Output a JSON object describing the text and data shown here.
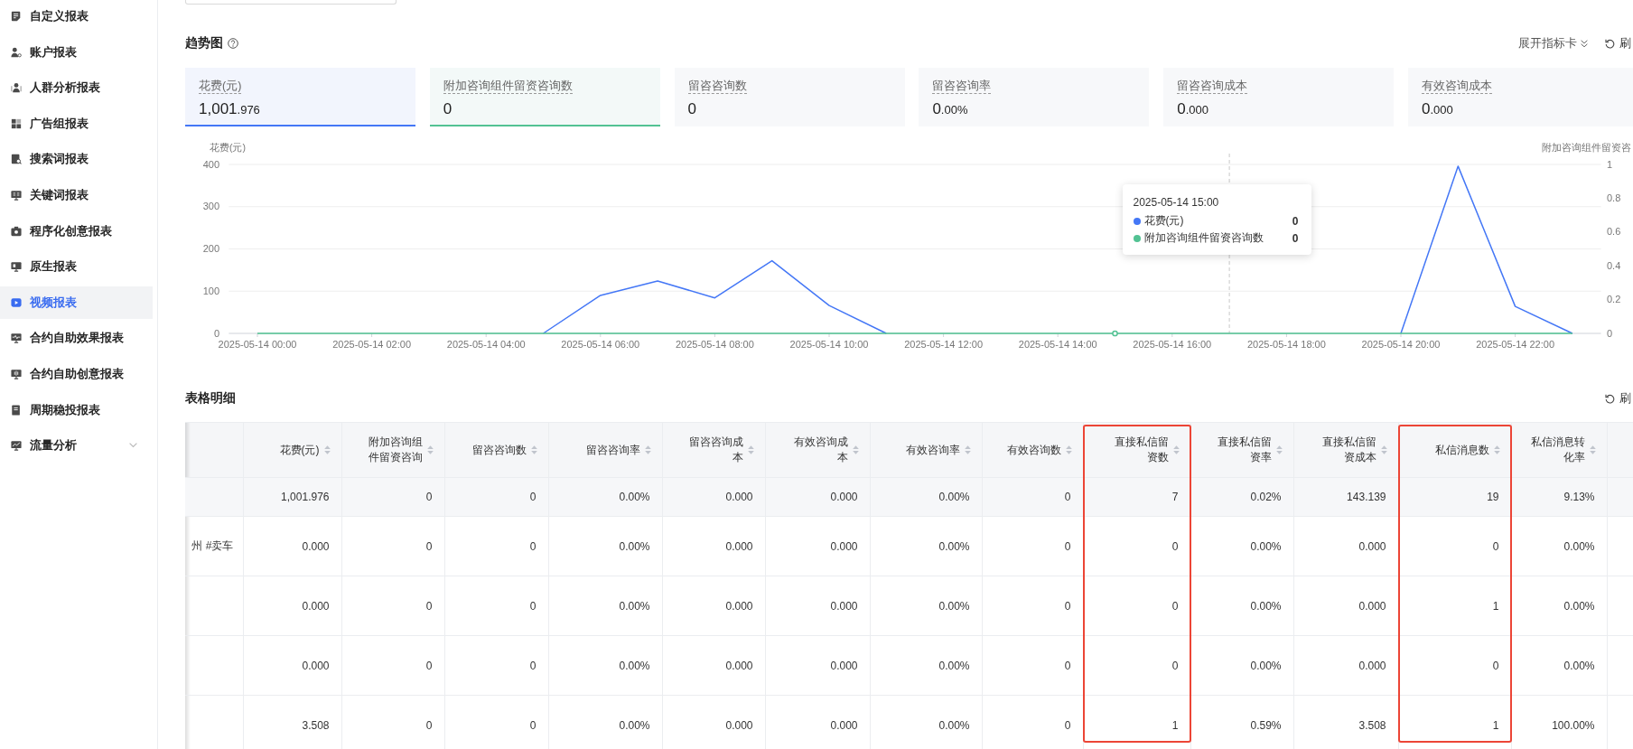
{
  "sidebar": {
    "items": [
      {
        "label": "自定义报表",
        "selected": false,
        "kind": "page"
      },
      {
        "label": "账户报表",
        "selected": false,
        "kind": "page"
      },
      {
        "label": "人群分析报表",
        "selected": false,
        "kind": "page"
      },
      {
        "label": "广告组报表",
        "selected": false,
        "kind": "page"
      },
      {
        "label": "搜索词报表",
        "selected": false,
        "kind": "page"
      },
      {
        "label": "关键词报表",
        "selected": false,
        "kind": "page"
      },
      {
        "label": "程序化创意报表",
        "selected": false,
        "kind": "page"
      },
      {
        "label": "原生报表",
        "selected": false,
        "kind": "page"
      },
      {
        "label": "视频报表",
        "selected": true,
        "kind": "page"
      },
      {
        "label": "合约自助效果报表",
        "selected": false,
        "kind": "page"
      },
      {
        "label": "合约自助创意报表",
        "selected": false,
        "kind": "page"
      },
      {
        "label": "周期稳投报表",
        "selected": false,
        "kind": "page"
      },
      {
        "label": "流量分析",
        "selected": false,
        "kind": "group"
      }
    ]
  },
  "trend": {
    "title": "趋势图",
    "expand_button": "展开指标卡",
    "refresh_button": "刷",
    "metric_cards": [
      {
        "label": "花费(元)",
        "value": "1,001.976",
        "selected": true,
        "color": "#4477f6"
      },
      {
        "label": "附加咨询组件留资咨询数",
        "value": "0",
        "selected": true,
        "color": "#52c293"
      },
      {
        "label": "留咨咨询数",
        "value": "0",
        "selected": false
      },
      {
        "label": "留咨咨询率",
        "value": "0.00%",
        "selected": false
      },
      {
        "label": "留咨咨询成本",
        "value": "0.000",
        "selected": false
      },
      {
        "label": "有效咨询成本",
        "value": "0.000",
        "selected": false
      }
    ],
    "chart_data": {
      "type": "line",
      "ylabel": "花费(元)",
      "y2label": "附加咨询组件留资咨",
      "grid": true,
      "legend": "upper right",
      "categories": [
        "2025-05-14 00:00",
        null,
        "2025-05-14 02:00",
        null,
        "2025-05-14 04:00",
        null,
        "2025-05-14 06:00",
        null,
        "2025-05-14 08:00",
        null,
        "2025-05-14 10:00",
        null,
        "2025-05-14 12:00",
        null,
        "2025-05-14 14:00",
        null,
        "2025-05-14 16:00",
        null,
        "2025-05-14 18:00",
        null,
        "2025-05-14 20:00",
        null,
        "2025-05-14 22:00",
        null
      ],
      "ylim": [
        0,
        400
      ],
      "yticks": [
        0,
        100,
        200,
        300,
        400
      ],
      "y2lim": [
        0,
        1
      ],
      "y2ticks": [
        0,
        0.2,
        0.4,
        0.6,
        0.8,
        1
      ],
      "series": [
        {
          "name": "花费(元)",
          "color": "#4477f6",
          "values": [
            null,
            null,
            null,
            null,
            null,
            0,
            90,
            124,
            84,
            172,
            66,
            0,
            null,
            null,
            null,
            null,
            null,
            null,
            null,
            null,
            0,
            396,
            64,
            0
          ]
        },
        {
          "name": "附加咨询组件留资咨询数",
          "color": "#52c293",
          "axis": "y2",
          "values": [
            0,
            0,
            0,
            0,
            0,
            0,
            0,
            0,
            0,
            0,
            0,
            0,
            0,
            0,
            0,
            0,
            0,
            0,
            0,
            0,
            0,
            0,
            0,
            0
          ]
        }
      ]
    },
    "tooltip": {
      "title": "2025-05-14 15:00",
      "values": [
        "0",
        "0"
      ]
    }
  },
  "details": {
    "title": "表格明细",
    "refresh_button": "刷",
    "table": {
      "columns": [
        {
          "label": "花费(元)",
          "highlighted": false
        },
        {
          "label": "附加咨询组件留资咨询",
          "highlighted": false
        },
        {
          "label": "留咨咨询数",
          "highlighted": false
        },
        {
          "label": "留咨咨询率",
          "highlighted": false
        },
        {
          "label": "留咨咨询成本",
          "highlighted": false
        },
        {
          "label": "有效咨询成本",
          "highlighted": false
        },
        {
          "label": "有效咨询率",
          "highlighted": false
        },
        {
          "label": "有效咨询数",
          "highlighted": false
        },
        {
          "label": "直接私信留资数",
          "highlighted": true
        },
        {
          "label": "直接私信留资率",
          "highlighted": false
        },
        {
          "label": "直接私信留资成本",
          "highlighted": false
        },
        {
          "label": "私信消息数",
          "highlighted": true
        },
        {
          "label": "私信消息转化率",
          "highlighted": false
        }
      ],
      "total_row": [
        "1,001.976",
        "0",
        "0",
        "0.00%",
        "0.000",
        "0.000",
        "0.00%",
        "0",
        "7",
        "0.02%",
        "143.139",
        "19",
        "9.13%"
      ],
      "rows": [
        {
          "column_1": "州 #卖车",
          "cells": [
            "0.000",
            "0",
            "0",
            "0.00%",
            "0.000",
            "0.000",
            "0.00%",
            "0",
            "0",
            "0.00%",
            "0.000",
            "0",
            "0.00%"
          ]
        },
        {
          "cells": [
            "0.000",
            "0",
            "0",
            "0.00%",
            "0.000",
            "0.000",
            "0.00%",
            "0",
            "0",
            "0.00%",
            "0.000",
            "1",
            "0.00%"
          ]
        },
        {
          "cells": [
            "0.000",
            "0",
            "0",
            "0.00%",
            "0.000",
            "0.000",
            "0.00%",
            "0",
            "0",
            "0.00%",
            "0.000",
            "0",
            "0.00%"
          ]
        },
        {
          "cells": [
            "3.508",
            "0",
            "0",
            "0.00%",
            "0.000",
            "0.000",
            "0.00%",
            "0",
            "1",
            "0.59%",
            "3.508",
            "1",
            "100.00%"
          ]
        }
      ]
    }
  }
}
